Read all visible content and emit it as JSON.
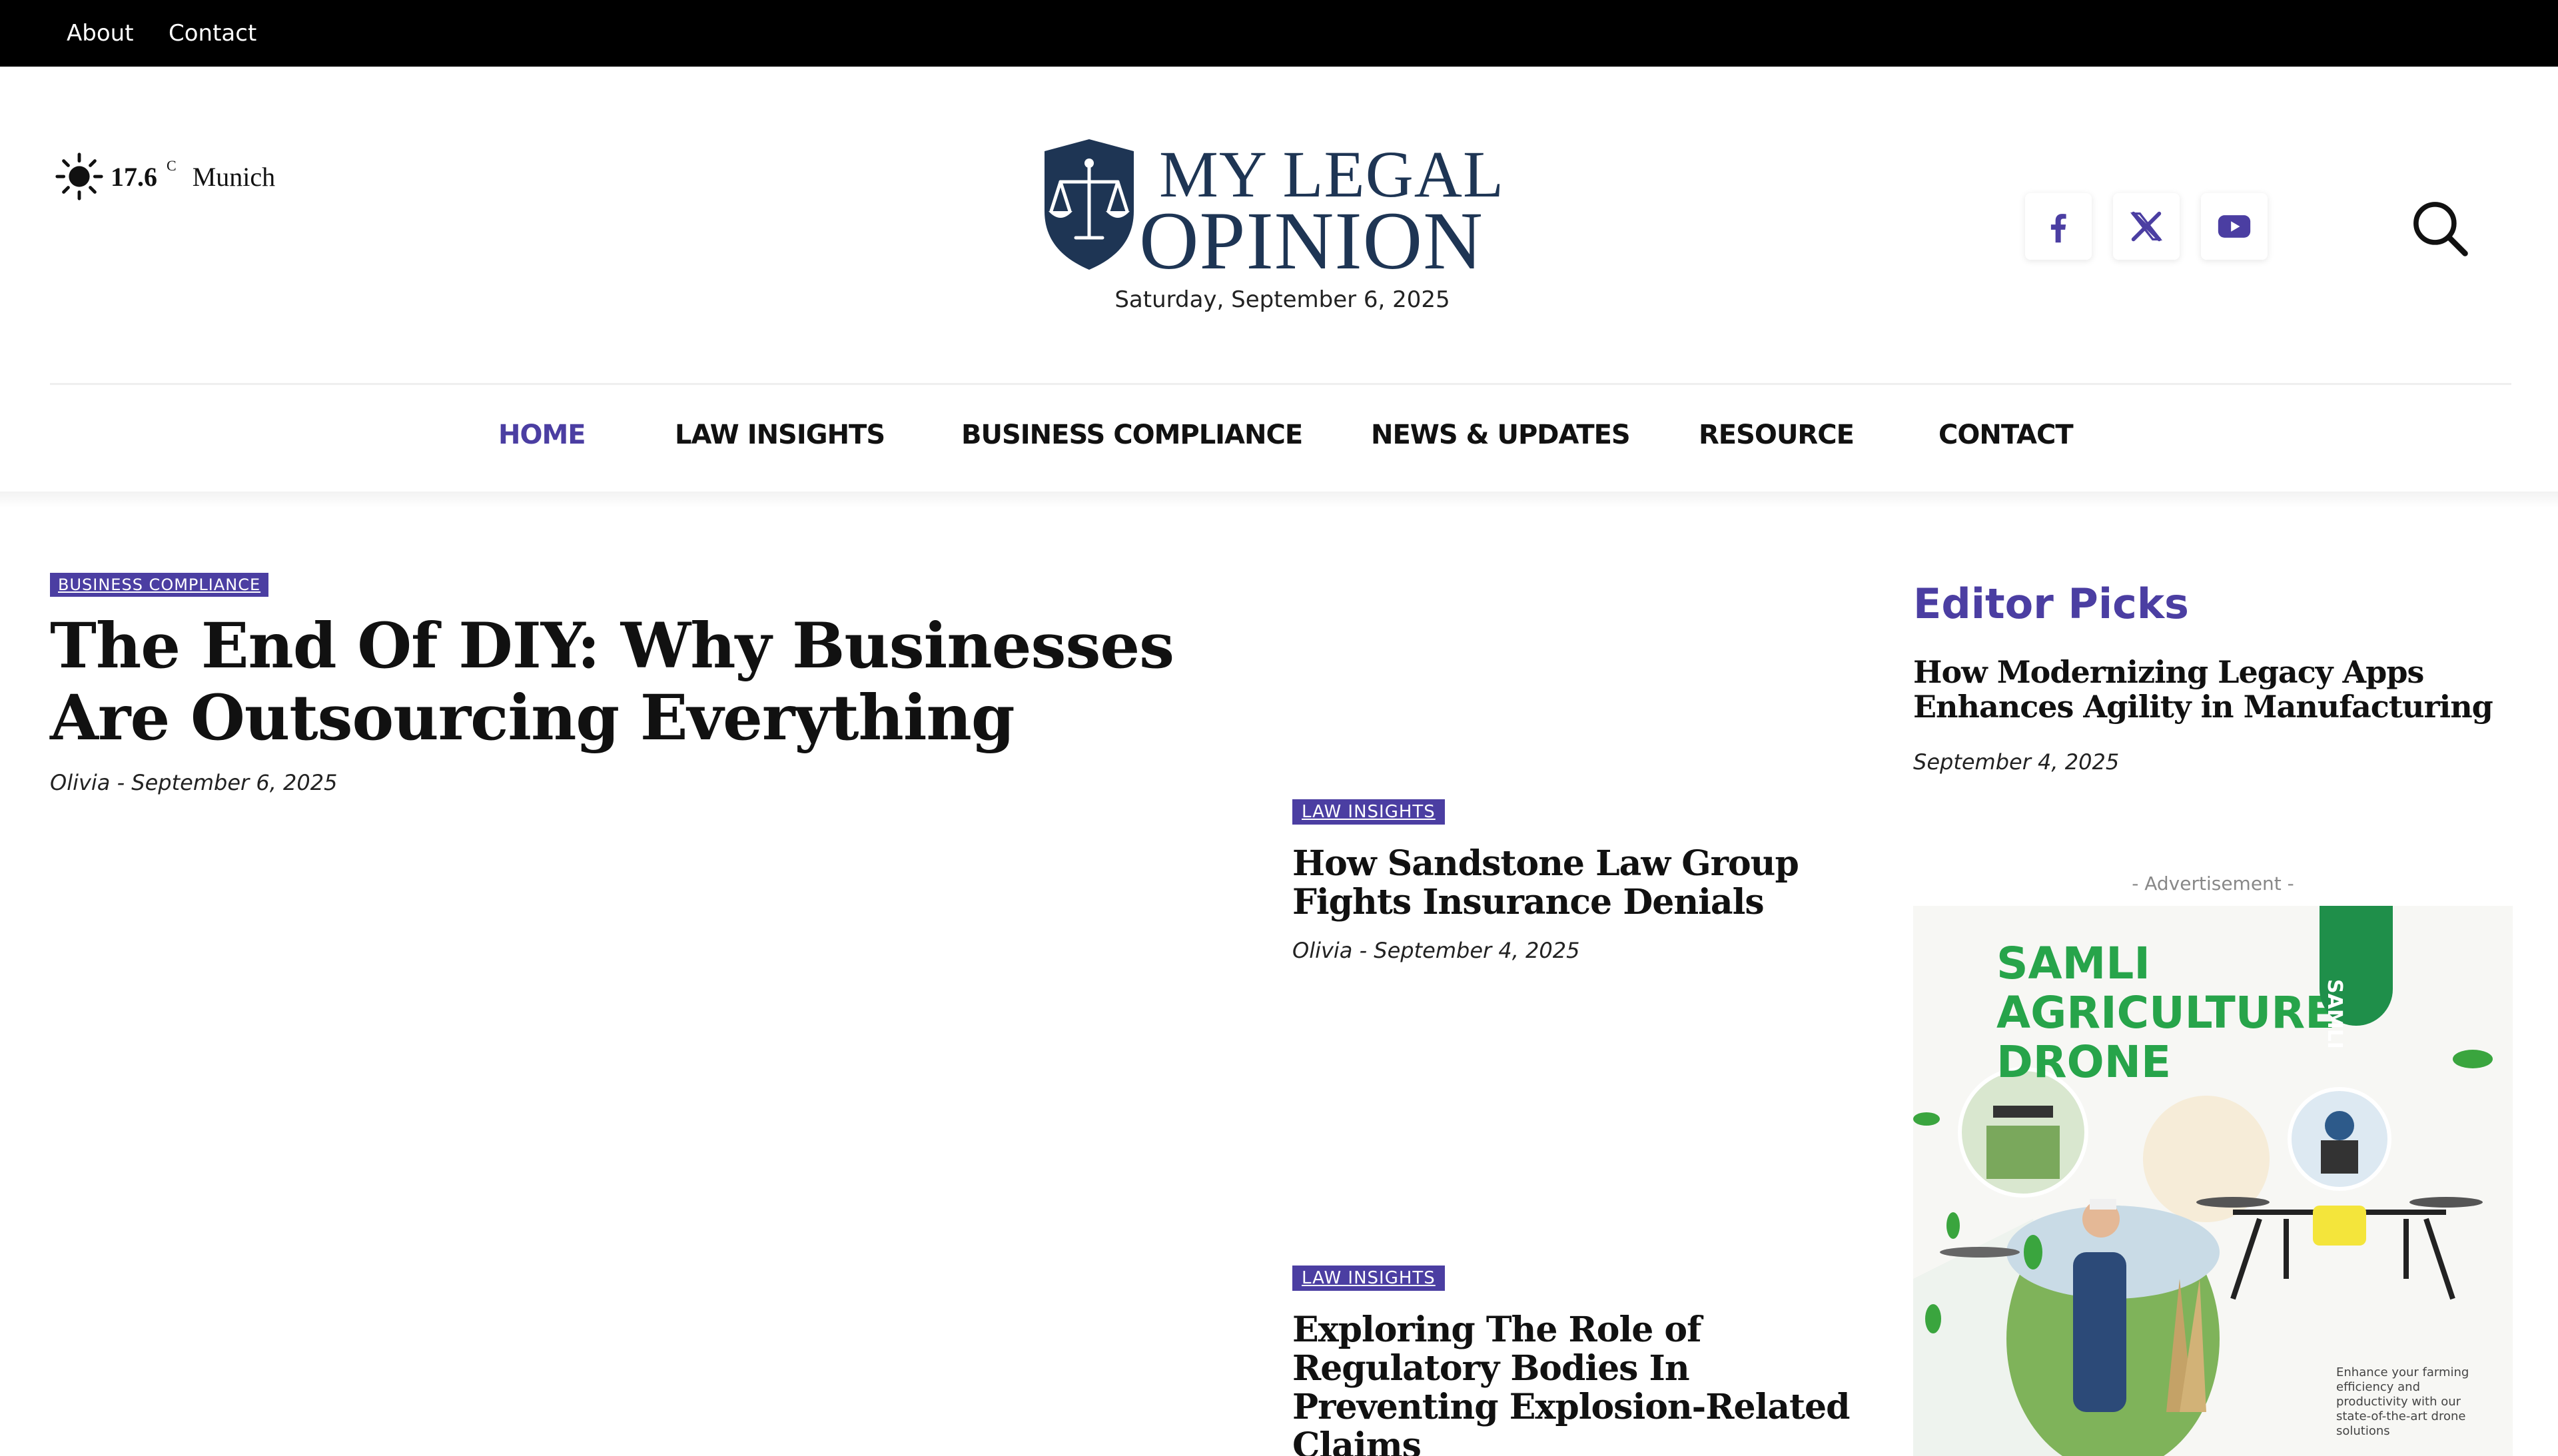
{
  "topbar": {
    "about": "About",
    "contact": "Contact"
  },
  "weather": {
    "temperature": "17.6",
    "unit": "C",
    "city": "Munich",
    "icon": "sun-icon"
  },
  "logo": {
    "line1": "MY LEGAL",
    "line2": "OPINION",
    "icon": "scales-shield-icon"
  },
  "date": "Saturday, September 6, 2025",
  "socials": [
    {
      "name": "facebook-icon"
    },
    {
      "name": "x-icon"
    },
    {
      "name": "youtube-icon"
    }
  ],
  "nav": {
    "items": [
      {
        "label": "HOME",
        "active": true
      },
      {
        "label": "LAW INSIGHTS"
      },
      {
        "label": "BUSINESS COMPLIANCE"
      },
      {
        "label": "NEWS & UPDATES"
      },
      {
        "label": "RESOURCE"
      },
      {
        "label": "CONTACT"
      }
    ]
  },
  "feature": {
    "category": "BUSINESS COMPLIANCE",
    "title": "The End Of DIY: Why Businesses Are Outsourcing Everything",
    "author": "Olivia",
    "date": "September 6, 2025"
  },
  "cards": [
    {
      "category": "LAW INSIGHTS",
      "title": "How Sandstone Law Group Fights Insurance Denials",
      "author": "Olivia",
      "date": "September 4, 2025"
    },
    {
      "category": "LAW INSIGHTS",
      "title": "Exploring The Role of Regulatory Bodies In Preventing Explosion-Related Claims"
    }
  ],
  "sidebar": {
    "title": "Editor Picks",
    "pick_title": "How Modernizing Legacy Apps Enhances Agility in Manufacturing",
    "pick_date": "September 4, 2025",
    "ad_label": "- Advertisement -",
    "ad": {
      "title_line1": "SAMLI",
      "title_line2": "AGRICULTURE",
      "title_line3": "DRONE",
      "tag": "SAMLI",
      "fine": "Enhance your farming efficiency and productivity with our state-of-the-art drone solutions"
    }
  },
  "colors": {
    "accent": "#4b3ea2",
    "logo_navy": "#1e3554",
    "ad_green": "#27a44a"
  }
}
